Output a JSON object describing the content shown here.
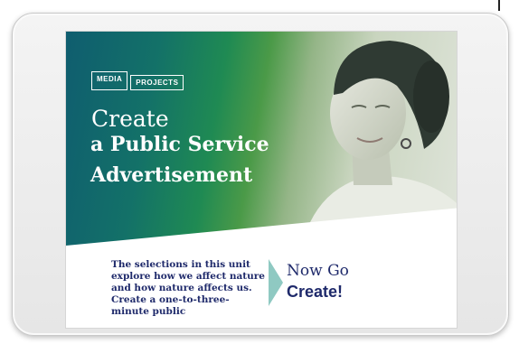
{
  "logo": {
    "part1": "MEDIA",
    "part2": "PROJECTS"
  },
  "hero": {
    "line1": "Create",
    "line2": "a Public Service",
    "line3": "Advertisement"
  },
  "body": {
    "text": "The selections in this unit explore how we affect nature and how nature affects us. Create a one-to-three-minute public"
  },
  "cta": {
    "line1": "Now Go",
    "line2": "Create!"
  },
  "colors": {
    "navy": "#1f2a6b",
    "teal": "#0f5d6f",
    "green": "#1f8a53"
  }
}
